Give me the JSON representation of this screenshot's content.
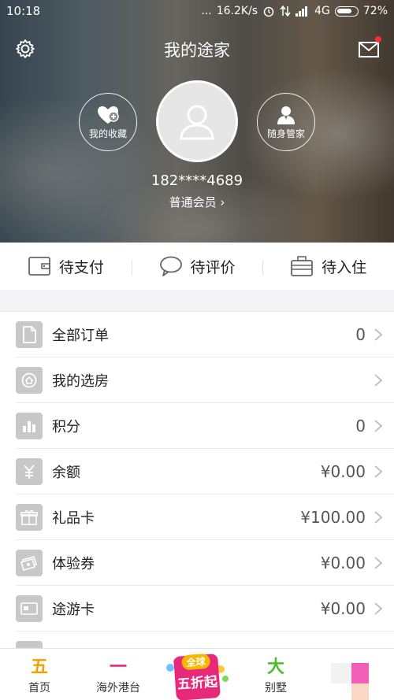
{
  "status_bar": {
    "time": "10:18",
    "dots": "...",
    "speed": "16.2K/s",
    "network": "4G",
    "battery": "72%"
  },
  "header": {
    "title": "我的途家"
  },
  "profile": {
    "favorites_label": "我的收藏",
    "butler_label": "随身管家",
    "phone": "182****4689",
    "member_level": "普通会员 ›"
  },
  "quick_actions": [
    {
      "label": "待支付",
      "icon": "wallet-icon"
    },
    {
      "label": "待评价",
      "icon": "chat-bubble-icon"
    },
    {
      "label": "待入住",
      "icon": "suitcase-icon"
    }
  ],
  "menu": [
    {
      "label": "全部订单",
      "value": "0",
      "icon": "document-icon"
    },
    {
      "label": "我的选房",
      "value": "",
      "icon": "house-search-icon"
    },
    {
      "label": "积分",
      "value": "0",
      "icon": "bar-chart-icon"
    },
    {
      "label": "余额",
      "value": "¥0.00",
      "icon": "yuan-icon"
    },
    {
      "label": "礼品卡",
      "value": "¥100.00",
      "icon": "gift-icon"
    },
    {
      "label": "体验券",
      "value": "¥0.00",
      "icon": "ticket-icon"
    },
    {
      "label": "途游卡",
      "value": "¥0.00",
      "icon": "card-icon"
    }
  ],
  "tabbar": {
    "tabs": [
      {
        "label": "首页",
        "glyph": "五",
        "color": "#f2a100"
      },
      {
        "label": "海外港台",
        "glyph": "一",
        "color": "#e8297a"
      },
      {
        "label": "",
        "glyph": "",
        "color": ""
      },
      {
        "label": "别墅",
        "glyph": "大",
        "color": "#4bbf2e"
      },
      {
        "label": "",
        "glyph": "",
        "color": ""
      }
    ],
    "promo_top": "全球",
    "promo_main": "五折起"
  },
  "colors": {
    "accent_pink": "#e8297a",
    "accent_yellow": "#f6b800",
    "icon_gray": "#c8c8c8"
  }
}
